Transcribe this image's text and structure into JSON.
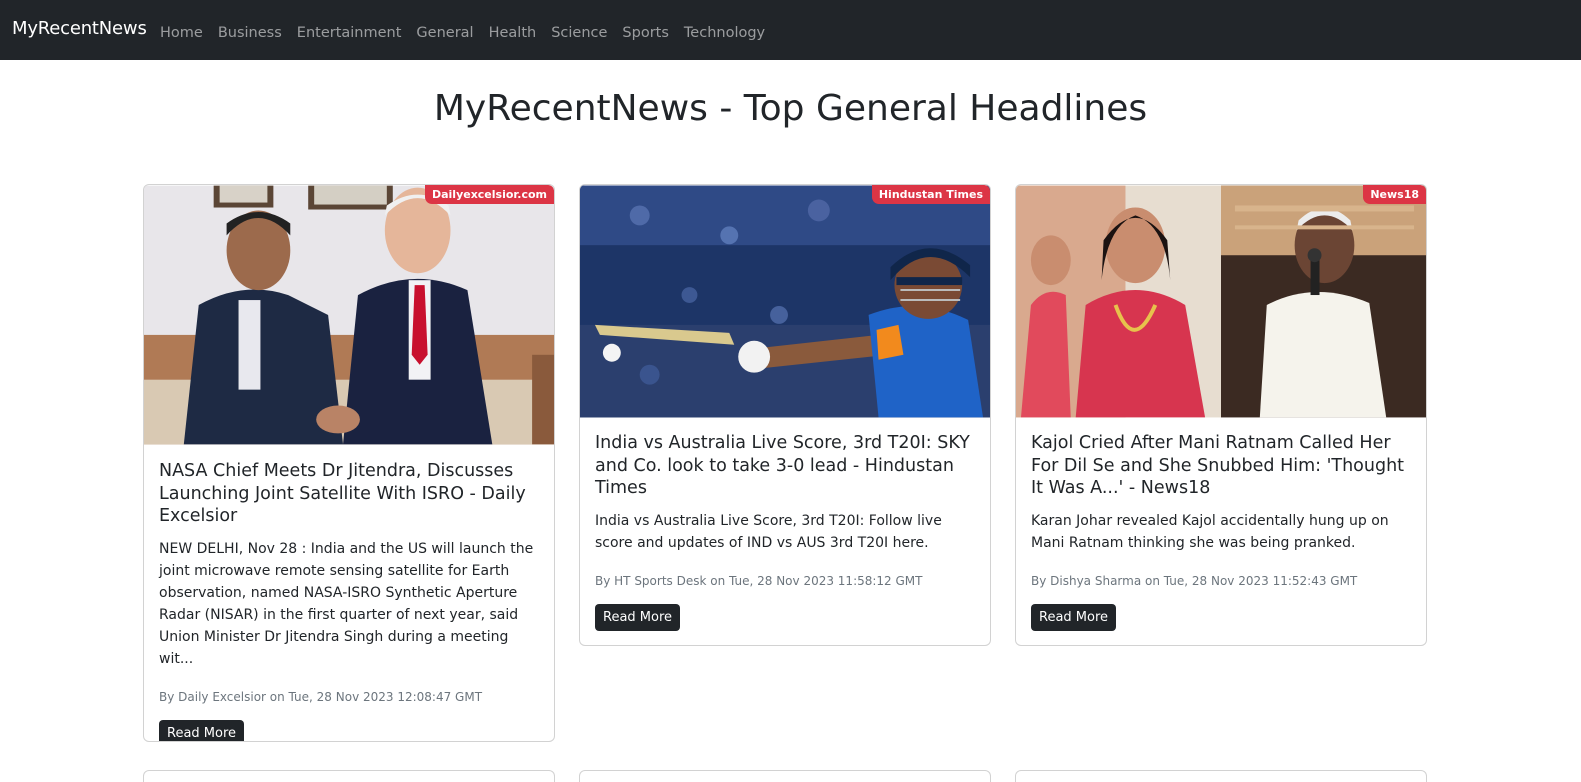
{
  "nav": {
    "brand": "MyRecentNews",
    "links": [
      "Home",
      "Business",
      "Entertainment",
      "General",
      "Health",
      "Science",
      "Sports",
      "Technology"
    ]
  },
  "page": {
    "title": "MyRecentNews - Top General Headlines"
  },
  "colors": {
    "navbar": "#212529",
    "badge": "#dc3545",
    "button": "#212529"
  },
  "articles": [
    {
      "source": "Dailyexcelsior.com",
      "title": "NASA Chief Meets Dr Jitendra, Discusses Launching Joint Satellite With ISRO - Daily Excelsior",
      "description": "NEW DELHI, Nov 28 : India and the US will launch the joint microwave remote sensing satellite for Earth observation, named NASA-ISRO Synthetic Aperture Radar (NISAR) in the first quarter of next year, said Union Minister Dr Jitendra Singh during a meeting wit...",
      "meta": "By Daily Excelsior on Tue, 28 Nov 2023 12:08:47 GMT",
      "button": "Read More",
      "image": "photo-two-men-handshake"
    },
    {
      "source": "Hindustan Times",
      "title": "India vs Australia Live Score, 3rd T20I: SKY and Co. look to take 3-0 lead - Hindustan Times",
      "description": "India vs Australia Live Score, 3rd T20I: Follow live score and updates of IND vs AUS 3rd T20I here.",
      "meta": "By HT Sports Desk on Tue, 28 Nov 2023 11:58:12 GMT",
      "button": "Read More",
      "image": "photo-cricket-batsman"
    },
    {
      "source": "News18",
      "title": "Kajol Cried After Mani Ratnam Called Her For Dil Se and She Snubbed Him: 'Thought It Was A...' - News18",
      "description": "Karan Johar revealed Kajol accidentally hung up on Mani Ratnam thinking she was being pranked.",
      "meta": "By Dishya Sharma on Tue, 28 Nov 2023 11:52:43 GMT",
      "button": "Read More",
      "image": "photo-event-collage"
    }
  ]
}
